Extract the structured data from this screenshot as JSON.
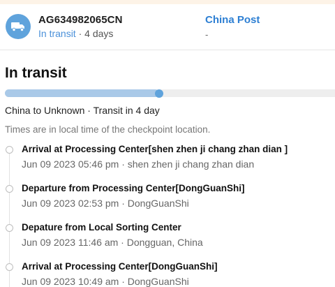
{
  "shipment": {
    "tracking_number": "AG634982065CN",
    "status": "In transit",
    "separator": " · ",
    "duration": "4 days",
    "carrier_name": "China Post",
    "carrier_sub": "-",
    "icon": "truck-icon",
    "accent_color": "#5fa3dc"
  },
  "summary": {
    "title": "In transit",
    "progress_fraction": 0.46,
    "route": "China to Unknown · Transit in 4 day",
    "note": "Times are in local time of the checkpoint location."
  },
  "events": [
    {
      "title": "Arrival at Processing Center[shen zhen ji chang zhan dian ]",
      "meta": "Jun 09 2023 05:46 pm · shen zhen ji chang zhan dian"
    },
    {
      "title": "Departure from Processing Center[DongGuanShi]",
      "meta": "Jun 09 2023 02:53 pm · DongGuanShi"
    },
    {
      "title": "Depature from Local Sorting Center",
      "meta": "Jun 09 2023 11:46 am · Dongguan, China"
    },
    {
      "title": "Arrival at Processing Center[DongGuanShi]",
      "meta": "Jun 09 2023 10:49 am · DongGuanShi"
    }
  ]
}
